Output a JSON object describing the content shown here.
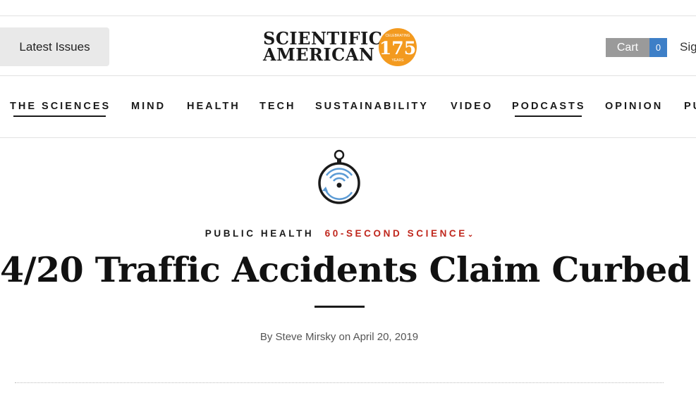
{
  "header": {
    "latest_issues_label": "Latest Issues",
    "logo": {
      "line1": "SCIENTIFIC",
      "line2": "AMERICAN",
      "badge_top": "CELEBRATING",
      "badge_number": "175",
      "badge_bottom": "YEARS"
    },
    "cart_label": "Cart",
    "cart_count": "0",
    "signin_label": "Sig"
  },
  "nav": {
    "items": [
      {
        "label": "THE SCIENCES",
        "active": true
      },
      {
        "label": "MIND",
        "active": false
      },
      {
        "label": "HEALTH",
        "active": false
      },
      {
        "label": "TECH",
        "active": false
      },
      {
        "label": "SUSTAINABILITY",
        "active": false
      },
      {
        "label": "VIDEO",
        "active": false
      },
      {
        "label": "PODCASTS",
        "active": true
      },
      {
        "label": "OPINION",
        "active": false
      },
      {
        "label": "PU",
        "active": false
      }
    ]
  },
  "article": {
    "section": "PUBLIC HEALTH",
    "series": "60-SECOND SCIENCE",
    "title": "4/20 Traffic Accidents Claim Curbed",
    "byline": "By Steve Mirsky on April 20, 2019"
  },
  "icons": {
    "podcast": "stopwatch-podcast-icon",
    "series_dropdown": "chevron-down-icon"
  },
  "colors": {
    "series_red": "#c0271d",
    "badge_orange": "#f39a1f",
    "cart_blue": "#3e7fc7",
    "icon_blue": "#5b9bd5"
  }
}
